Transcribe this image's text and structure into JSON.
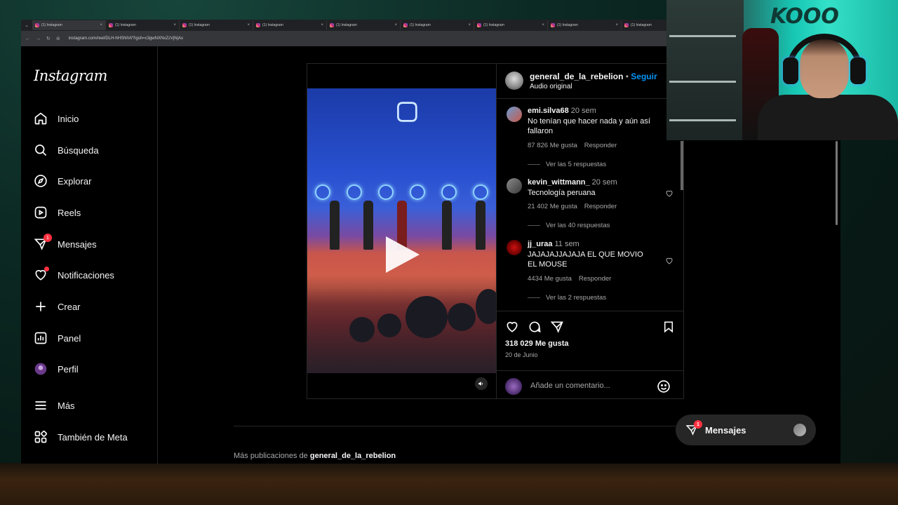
{
  "browser": {
    "tabs": [
      {
        "title": "(1) Instagram",
        "active": true
      },
      {
        "title": "(1) Instagram",
        "active": false
      },
      {
        "title": "(1) Instagram",
        "active": false
      },
      {
        "title": "(1) Instagram",
        "active": false
      },
      {
        "title": "(1) Instagram",
        "active": false
      },
      {
        "title": "(1) Instagram",
        "active": false
      },
      {
        "title": "(1) Instagram",
        "active": false
      },
      {
        "title": "(1) Instagram",
        "active": false
      },
      {
        "title": "(1) Instagram",
        "active": false
      }
    ],
    "url": "instagram.com/reel/DLH-hHSNiVl/?igsh=c3gwNXNxZzVjNjAx"
  },
  "sidebar": {
    "logo": "Instagram",
    "items": [
      {
        "label": "Inicio",
        "icon": "home-icon"
      },
      {
        "label": "Búsqueda",
        "icon": "search-icon"
      },
      {
        "label": "Explorar",
        "icon": "compass-icon"
      },
      {
        "label": "Reels",
        "icon": "reels-icon"
      },
      {
        "label": "Mensajes",
        "icon": "messenger-icon",
        "badge": "1"
      },
      {
        "label": "Notificaciones",
        "icon": "heart-icon"
      },
      {
        "label": "Crear",
        "icon": "plus-icon"
      },
      {
        "label": "Panel",
        "icon": "chart-icon"
      },
      {
        "label": "Perfil",
        "icon": "profile-avatar"
      },
      {
        "label": "Más",
        "icon": "menu-icon"
      },
      {
        "label": "También de Meta",
        "icon": "meta-apps-icon"
      }
    ]
  },
  "post": {
    "username": "general_de_la_rebelion",
    "separator": "•",
    "follow": "Seguir",
    "audio": "Audio original",
    "comments": [
      {
        "user": "emi.silva68",
        "time": "20 sem",
        "text": "No tenían que hacer nada y aún así fallaron",
        "likes": "87 826 Me gusta",
        "reply": "Responder",
        "replies": "Ver las 5 respuestas"
      },
      {
        "user": "kevin_wittmann_",
        "time": "20 sem",
        "text": "Tecnología peruana",
        "likes": "21 402 Me gusta",
        "reply": "Responder",
        "replies": "Ver las 40 respuestas"
      },
      {
        "user": "jj_uraa",
        "time": "11 sem",
        "text": "JAJAJAJJAJAJA EL QUE MOVIO EL MOUSE",
        "likes": "4434 Me gusta",
        "reply": "Responder",
        "replies": "Ver las 2 respuestas"
      }
    ],
    "like_count": "318 029 Me gusta",
    "date": "20 de Junio",
    "comment_placeholder": "Añade un comentario..."
  },
  "more_posts": {
    "prefix": "Más publicaciones de",
    "user": "general_de_la_rebelion"
  },
  "messages_pill": {
    "label": "Mensajes",
    "badge": "1"
  },
  "colors": {
    "accent": "#0095f6",
    "badge": "#ff3040",
    "background": "#000000"
  }
}
